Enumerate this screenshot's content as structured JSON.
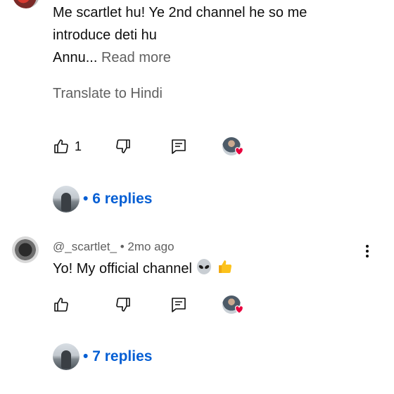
{
  "first_comment": {
    "text_lines": [
      "Me scartlet hu! Ye 2nd channel he so me",
      "introduce deti hu"
    ],
    "truncated_line": "Annu...",
    "read_more_label": "Read more",
    "translate_label": "Translate to Hindi",
    "likes": "1",
    "replies_label": "6 replies"
  },
  "second_comment": {
    "author": "@_scartlet_",
    "separator": "•",
    "age": "2mo ago",
    "text": "Yo! My official channel",
    "emojis": [
      "alien-emoji",
      "thumbs-up-emoji"
    ],
    "replies_label": "7 replies"
  },
  "replies_bullet": "•",
  "icons": {
    "like": "thumbs-up-icon",
    "dislike": "thumbs-down-icon",
    "reply": "comment-icon",
    "creator_heart": "creator-heart-icon",
    "more": "more-vertical-icon"
  },
  "colors": {
    "link": "#065fd4",
    "secondary_text": "#606060",
    "heart": "#e8003d"
  }
}
